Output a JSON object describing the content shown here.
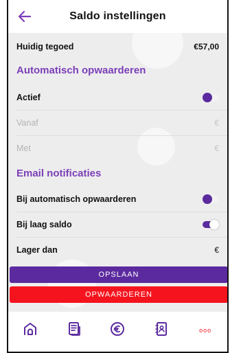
{
  "header": {
    "title": "Saldo instellingen",
    "back_icon": "arrow-left-icon"
  },
  "balance": {
    "label": "Huidig tegoed",
    "value": "€57,00"
  },
  "auto_topup": {
    "section_title": "Automatisch opwaarderen",
    "active_label": "Actief",
    "active_on": false,
    "from_label": "Vanaf",
    "from_currency": "€",
    "amount_label": "Met",
    "amount_currency": "€"
  },
  "email": {
    "section_title": "Email notificaties",
    "auto_label": "Bij automatisch opwaarderen",
    "auto_on": false,
    "low_label": "Bij laag saldo",
    "low_on": true,
    "below_label": "Lager dan",
    "below_currency": "€"
  },
  "buttons": {
    "save": "OPSLAAN",
    "topup": "OPWAARDEREN"
  },
  "tabbar": {
    "items": [
      {
        "icon": "home-icon"
      },
      {
        "icon": "document-icon"
      },
      {
        "icon": "euro-icon"
      },
      {
        "icon": "contacts-icon"
      },
      {
        "icon": "more-icon",
        "label": "ooo"
      }
    ]
  },
  "colors": {
    "purple": "#5b2a9e",
    "section": "#7b3fb8",
    "red": "#f5141e"
  }
}
